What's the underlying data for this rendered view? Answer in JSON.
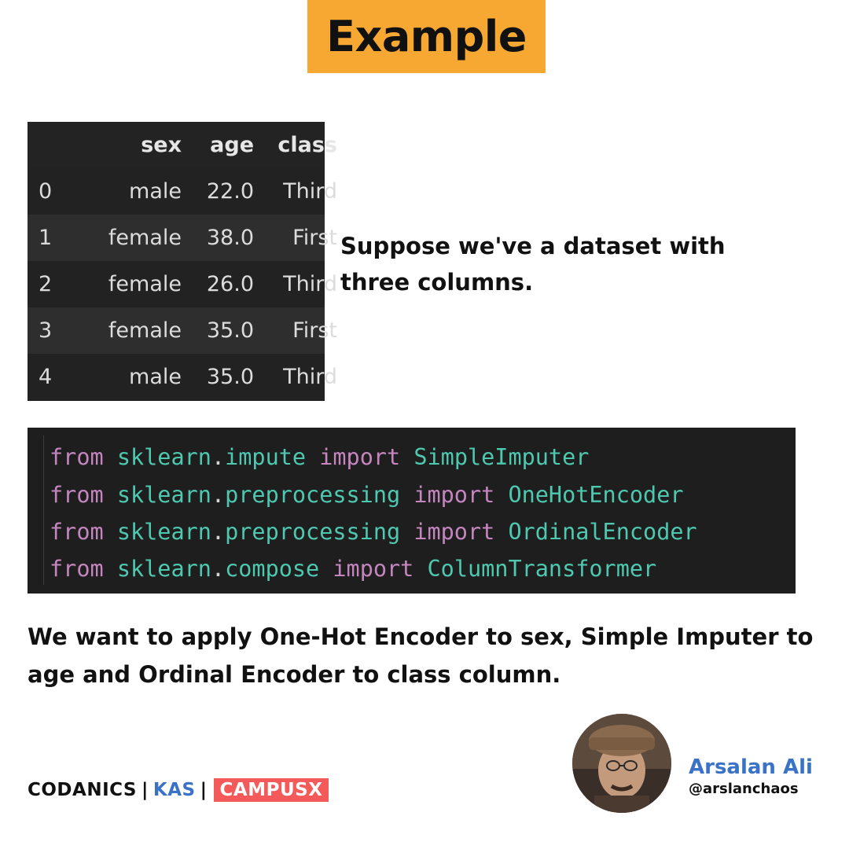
{
  "title": "Example",
  "dataframe": {
    "columns": [
      "",
      "sex",
      "age",
      "class"
    ],
    "rows": [
      [
        "0",
        "male",
        "22.0",
        "Third"
      ],
      [
        "1",
        "female",
        "38.0",
        "First"
      ],
      [
        "2",
        "female",
        "26.0",
        "Third"
      ],
      [
        "3",
        "female",
        "35.0",
        "First"
      ],
      [
        "4",
        "male",
        "35.0",
        "Third"
      ]
    ]
  },
  "description": "Suppose we've a dataset with three columns.",
  "code": {
    "lines": [
      {
        "kw1": "from",
        "module": "sklearn",
        "sub": "impute",
        "kw2": "import",
        "name": "SimpleImputer"
      },
      {
        "kw1": "from",
        "module": "sklearn",
        "sub": "preprocessing",
        "kw2": "import",
        "name": "OneHotEncoder"
      },
      {
        "kw1": "from",
        "module": "sklearn",
        "sub": "preprocessing",
        "kw2": "import",
        "name": "OrdinalEncoder"
      },
      {
        "kw1": "from",
        "module": "sklearn",
        "sub": "compose",
        "kw2": "import",
        "name": "ColumnTransformer"
      }
    ]
  },
  "body_text": "We want to apply One-Hot Encoder to sex, Simple Imputer to age and Ordinal Encoder to class column.",
  "branding": {
    "part1": "CODANICS",
    "separator": "|",
    "part2": "KAS",
    "part3": "CAMPUSX"
  },
  "author": {
    "name": "Arsalan Ali",
    "handle": "@arslanchaos"
  },
  "colors": {
    "title_bg": "#f6a832",
    "kas": "#3a72c8",
    "campusx_bg": "#f55a5a",
    "code_keyword": "#c586c0",
    "code_module": "#4ec9b0"
  }
}
